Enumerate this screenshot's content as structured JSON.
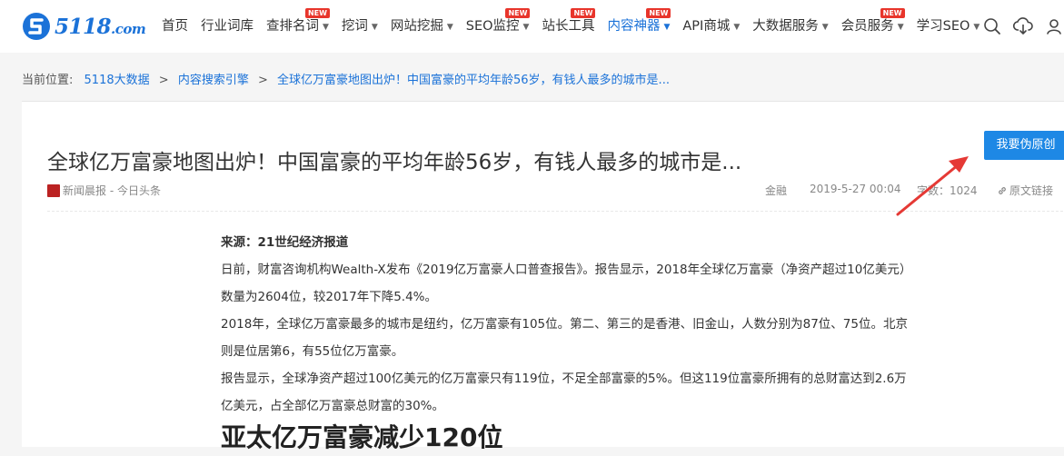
{
  "logo": {
    "text": "5118",
    "suffix": ".com"
  },
  "nav": [
    {
      "label": "首页",
      "caret": false,
      "new": false,
      "active": false,
      "name": "nav-home"
    },
    {
      "label": "行业词库",
      "caret": false,
      "new": false,
      "active": false,
      "name": "nav-industry-lexicon"
    },
    {
      "label": "查排名词",
      "caret": true,
      "new": true,
      "active": false,
      "name": "nav-rank-query"
    },
    {
      "label": "挖词",
      "caret": true,
      "new": false,
      "active": false,
      "name": "nav-keyword-mining"
    },
    {
      "label": "网站挖掘",
      "caret": true,
      "new": false,
      "active": false,
      "name": "nav-site-mining"
    },
    {
      "label": "SEO监控",
      "caret": true,
      "new": true,
      "active": false,
      "name": "nav-seo-monitor"
    },
    {
      "label": "站长工具",
      "caret": false,
      "new": true,
      "active": false,
      "name": "nav-webmaster-tools"
    },
    {
      "label": "内容神器",
      "caret": true,
      "new": true,
      "active": true,
      "name": "nav-content-tools"
    },
    {
      "label": "API商城",
      "caret": true,
      "new": false,
      "active": false,
      "name": "nav-api-store"
    },
    {
      "label": "大数据服务",
      "caret": true,
      "new": false,
      "active": false,
      "name": "nav-big-data"
    },
    {
      "label": "会员服务",
      "caret": true,
      "new": true,
      "active": false,
      "name": "nav-membership"
    },
    {
      "label": "学习SEO",
      "caret": true,
      "new": false,
      "active": false,
      "name": "nav-learn-seo"
    }
  ],
  "badge_new": "NEW",
  "breadcrumb": {
    "prefix": "当前位置:",
    "items": [
      "5118大数据",
      "内容搜索引擎",
      "全球亿万富豪地图出炉！中国富豪的平均年龄56岁，有钱人最多的城市是..."
    ],
    "separator": ">"
  },
  "article": {
    "title": "全球亿万富豪地图出炉！中国富豪的平均年龄56岁，有钱人最多的城市是...",
    "rewrite_button": "我要伪原创",
    "source_site": "新闻晨报 - 今日头条",
    "category": "金融",
    "date": "2019-5-27 00:04",
    "word_count": "字数：1024",
    "original_link": "原文链接",
    "source_line": "来源：21世纪经济报道",
    "paragraphs": [
      "日前，财富咨询机构Wealth-X发布《2019亿万富豪人口普查报告》。报告显示，2018年全球亿万富豪（净资产超过10亿美元）数量为2604位，较2017年下降5.4%。",
      "2018年，全球亿万富豪最多的城市是纽约，亿万富豪有105位。第二、第三的是香港、旧金山，人数分别为87位、75位。北京则是位居第6，有55位亿万富豪。",
      "报告显示，全球净资产超过100亿美元的亿万富豪只有119位，不足全部富豪的5%。但这119位富豪所拥有的总财富达到2.6万亿美元，占全部亿万富豪总财富的30%。"
    ],
    "subheading": "亚太亿万富豪减少120位"
  },
  "colors": {
    "brand": "#1b72d8",
    "button": "#1e88e5",
    "badge": "#e8352b",
    "arrow": "#e53935"
  },
  "icons": [
    "search-icon",
    "cloud-download-icon",
    "user-icon",
    "link-icon"
  ]
}
